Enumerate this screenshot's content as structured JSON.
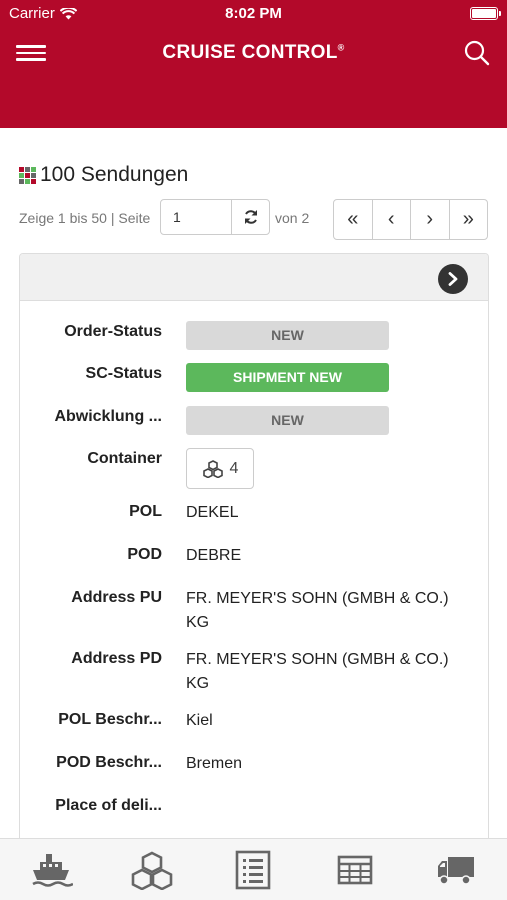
{
  "status_bar": {
    "carrier": "Carrier",
    "time": "8:02 PM"
  },
  "header": {
    "title": "CRUISE CONTROL",
    "trademark": "®"
  },
  "list": {
    "count_title": "100 Sendungen"
  },
  "pagination": {
    "info": "Zeige 1 bis 50 | Seite",
    "page_value": "1",
    "of_text": "von 2",
    "nav": [
      "«",
      "‹",
      "›",
      "»"
    ]
  },
  "shipment": {
    "order_status_label": "Order-Status",
    "order_status_value": "NEW",
    "sc_status_label": "SC-Status",
    "sc_status_value": "SHIPMENT NEW",
    "abwicklung_label": "Abwicklung ...",
    "abwicklung_value": "NEW",
    "container_label": "Container",
    "container_count": "4",
    "pol_label": "POL",
    "pol_value": "DEKEL",
    "pod_label": "POD",
    "pod_value": "DEBRE",
    "address_pu_label": "Address PU",
    "address_pu_value": "FR. MEYER'S SOHN (GMBH & CO.) KG",
    "address_pd_label": "Address PD",
    "address_pd_value": "FR. MEYER'S SOHN (GMBH & CO.) KG",
    "pol_desc_label": "POL Beschr...",
    "pol_desc_value": "Kiel",
    "pod_desc_label": "POD Beschr...",
    "pod_desc_value": "Bremen",
    "place_delivery_label": "Place of deli...",
    "place_delivery_value": ""
  },
  "colors": {
    "brand": "#b3092a",
    "success": "#5cb85c",
    "neutral_badge": "#d9d9d9"
  },
  "tabbar": {
    "icons": [
      "ship-icon",
      "cubes-icon",
      "list-icon",
      "table-icon",
      "truck-icon"
    ]
  }
}
